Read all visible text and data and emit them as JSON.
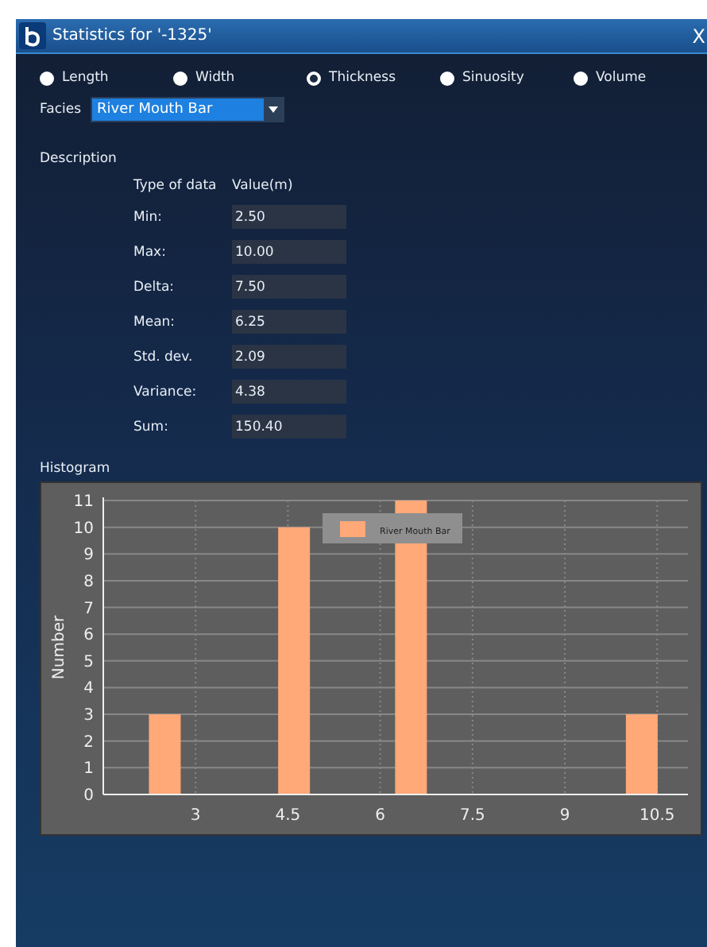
{
  "window": {
    "title": "Statistics for '-1325'",
    "close": "X"
  },
  "measures": [
    {
      "label": "Length",
      "selected": false
    },
    {
      "label": "Width",
      "selected": false
    },
    {
      "label": "Thickness",
      "selected": true
    },
    {
      "label": "Sinuosity",
      "selected": false
    },
    {
      "label": "Volume",
      "selected": false
    }
  ],
  "facies": {
    "label": "Facies",
    "value": "River Mouth Bar"
  },
  "description": {
    "title": "Description",
    "columns": [
      "Type of data",
      "Value(m)"
    ],
    "rows": [
      {
        "label": "Min:",
        "value": "2.50"
      },
      {
        "label": "Max:",
        "value": "10.00"
      },
      {
        "label": "Delta:",
        "value": "7.50"
      },
      {
        "label": "Mean:",
        "value": "6.25"
      },
      {
        "label": "Std. dev.",
        "value": "2.09"
      },
      {
        "label": "Variance:",
        "value": "4.38"
      },
      {
        "label": "Sum:",
        "value": "150.40"
      }
    ]
  },
  "histogram": {
    "title": "Histogram",
    "chart_data": {
      "type": "bar",
      "grid": true,
      "ylabel": "Number",
      "x": [
        2.5,
        4.6,
        6.5,
        10.25
      ],
      "series": [
        {
          "name": "River Mouth Bar",
          "color": "#ffa878",
          "values": [
            3,
            10,
            11,
            3
          ]
        }
      ],
      "xlim": [
        1.5,
        11
      ],
      "ylim": [
        0,
        11
      ],
      "xticks": [
        3,
        4.5,
        6,
        7.5,
        9,
        10.5
      ],
      "yticks": [
        0,
        1,
        2,
        3,
        4,
        5,
        6,
        7,
        8,
        9,
        10,
        11
      ]
    }
  }
}
